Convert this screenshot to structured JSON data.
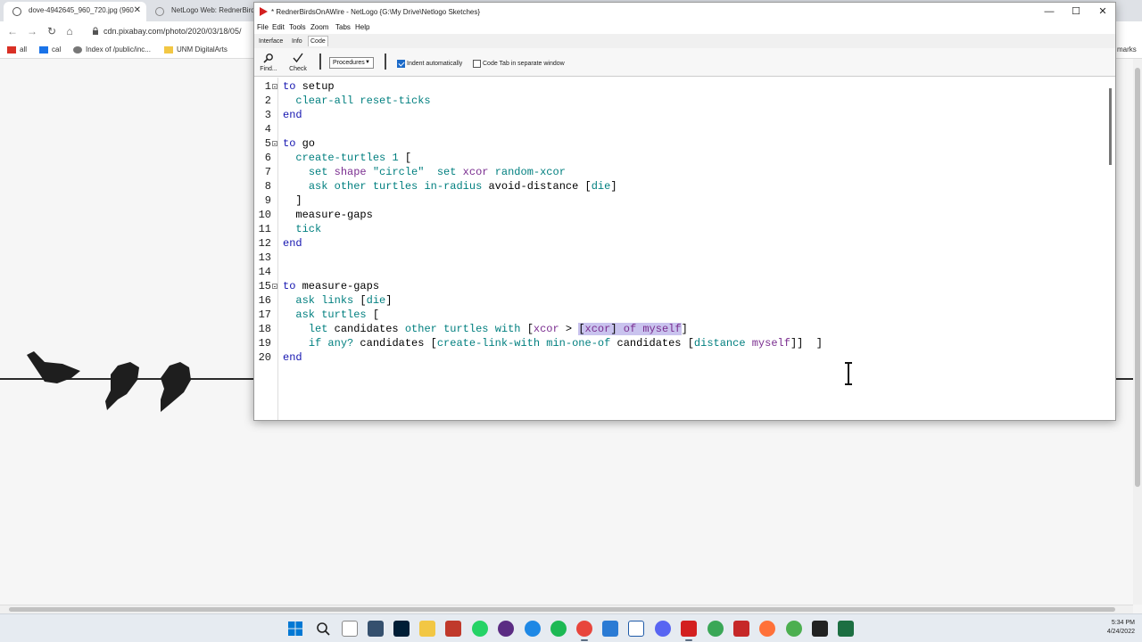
{
  "browser": {
    "tabs": [
      {
        "title": "dove-4942645_960_720.jpg (960",
        "active": true
      },
      {
        "title": "NetLogo Web: RednerBirds",
        "active": false
      }
    ],
    "url": "cdn.pixabay.com/photo/2020/03/18/05/",
    "bookmarks": [
      "all",
      "cal",
      "Index of /public/inc...",
      "UNM DigitalArts"
    ],
    "bookmarks_right": "marks"
  },
  "netlogo": {
    "title": "* RednerBirdsOnAWire - NetLogo {G:\\My Drive\\Netlogo Sketches}",
    "menu": [
      "File",
      "Edit",
      "Tools",
      "Zoom",
      "Tabs",
      "Help"
    ],
    "tabs": [
      "Interface",
      "Info",
      "Code"
    ],
    "active_tab": "Code",
    "toolbar": {
      "find_label": "Find...",
      "check_label": "Check",
      "procedures_label": "Procedures",
      "indent_label": "Indent automatically",
      "indent_checked": true,
      "separate_label": "Code Tab in separate window",
      "separate_checked": false
    },
    "code_lines": [
      "to setup",
      "  clear-all reset-ticks",
      "end",
      "",
      "to go",
      "  create-turtles 1 [",
      "    set shape \"circle\"  set xcor random-xcor",
      "    ask other turtles in-radius avoid-distance [die]",
      "  ]",
      "  measure-gaps",
      "  tick",
      "end",
      "",
      "",
      "to measure-gaps",
      "  ask links [die]",
      "  ask turtles [",
      "    let candidates other turtles with [xcor > [xcor] of myself]",
      "    if any? candidates [create-link-with min-one-of candidates [distance myself]]  ]",
      "end"
    ]
  },
  "taskbar": {
    "time": "5:34 PM",
    "date": "4/24/2022"
  },
  "colors": {
    "keyword": "#1515b0",
    "primitive": "#007f7f",
    "reporter": "#7a2d8f",
    "selection": "#c9c3ee"
  }
}
